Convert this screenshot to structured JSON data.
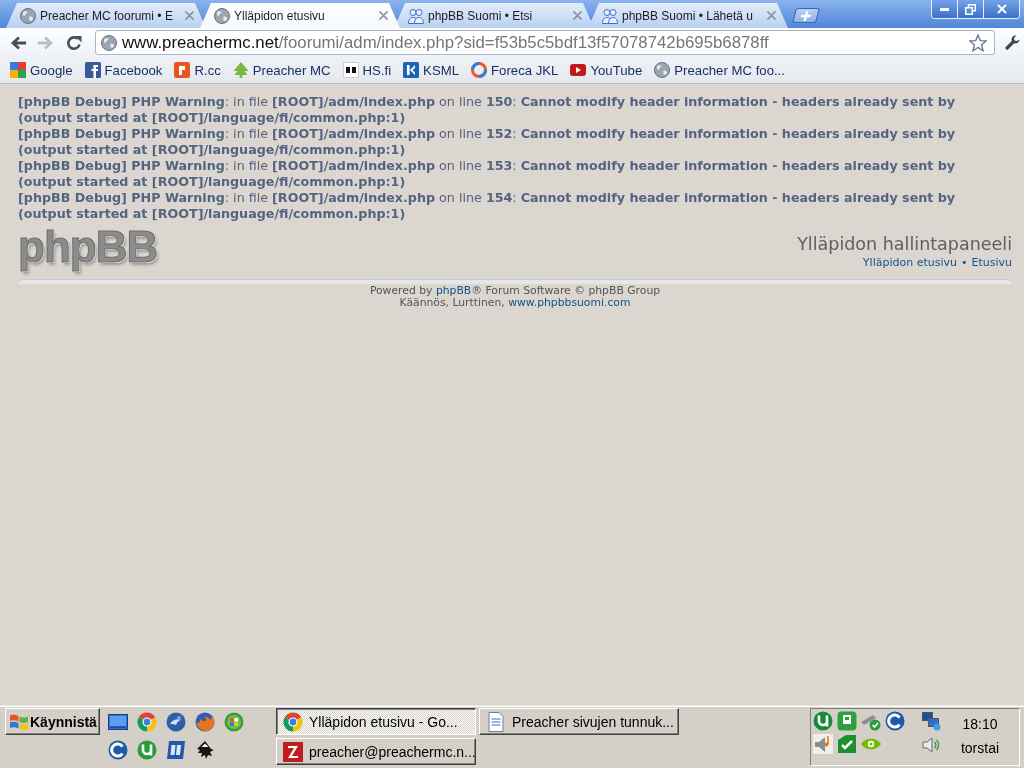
{
  "tabs": [
    {
      "title": "Preacher MC foorumi • E",
      "kind": "globe",
      "selected": false
    },
    {
      "title": "Ylläpidon etusivu",
      "kind": "globe",
      "selected": true
    },
    {
      "title": "phpBB Suomi • Etsi",
      "kind": "group",
      "selected": false
    },
    {
      "title": "phpBB Suomi • Lähetä u",
      "kind": "group",
      "selected": false
    }
  ],
  "toolbar": {
    "nav_buttons": [
      {
        "kind": "back",
        "disabled": false
      },
      {
        "kind": "forward",
        "disabled": true
      },
      {
        "kind": "reload",
        "disabled": false
      }
    ],
    "address": {
      "host": "www.preachermc.net",
      "path": "/foorumi/adm/index.php?sid=f53b5c5bdf13f57078742b695b6878ff"
    },
    "starred": false
  },
  "bookmarks": [
    {
      "label": "Google",
      "kind": "squares"
    },
    {
      "label": "Facebook",
      "kind": "ftile"
    },
    {
      "label": "R.cc",
      "kind": "rtile"
    },
    {
      "label": "Preacher MC",
      "kind": "tree"
    },
    {
      "label": "HS.fi",
      "kind": "hstile"
    },
    {
      "label": "KSML",
      "kind": "ktile"
    },
    {
      "label": "Foreca JKL",
      "kind": "ring"
    },
    {
      "label": "YouTube",
      "kind": "play"
    },
    {
      "label": "Preacher MC foo...",
      "kind": "globe"
    }
  ],
  "page": {
    "debug_messages": [
      "**[phpBB Debug] PHP Warning**: in file **[ROOT]/adm/index.php** on line **150**: **Cannot modify header information - headers already sent by (output started at [ROOT]/language/fi/common.php:1)**",
      "**[phpBB Debug] PHP Warning**: in file **[ROOT]/adm/index.php** on line **152**: **Cannot modify header information - headers already sent by (output started at [ROOT]/language/fi/common.php:1)**",
      "**[phpBB Debug] PHP Warning**: in file **[ROOT]/adm/index.php** on line **153**: **Cannot modify header information - headers already sent by (output started at [ROOT]/language/fi/common.php:1)**",
      "**[phpBB Debug] PHP Warning**: in file **[ROOT]/adm/index.php** on line **154**: **Cannot modify header information - headers already sent by (output started at [ROOT]/language/fi/common.php:1)**"
    ],
    "logo": "phpBB",
    "title": "Ylläpidon hallintapaneeli",
    "nav_links": [
      "Ylläpidon etusivu",
      "Etusivu"
    ],
    "nav_separator": "•",
    "footer": [
      {
        "text": "Powered by",
        "link": "phpBB",
        "after": "® Forum Software © phpBB Group"
      },
      {
        "text": "Käännös, Lurttinen,",
        "link": "www.phpbbsuomi.com"
      }
    ]
  },
  "taskbar": {
    "start": "Käynnistä",
    "tasks": [
      {
        "label": "Ylläpidon etusivu - Go...",
        "kind": "browser",
        "selected": true
      },
      {
        "label": "Preacher sivujen tunnuk...",
        "kind": "document",
        "selected": false
      },
      {
        "label": "preacher@preachermc.n...",
        "kind": "ftp",
        "selected": false
      }
    ],
    "clock": {
      "time": "18:10",
      "day": "torstai"
    }
  }
}
